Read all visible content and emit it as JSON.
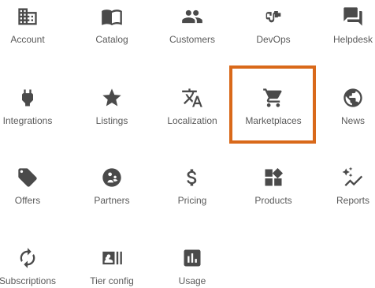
{
  "tiles": [
    {
      "label": "Account",
      "icon": "building-icon"
    },
    {
      "label": "Catalog",
      "icon": "book-icon"
    },
    {
      "label": "Customers",
      "icon": "people-icon"
    },
    {
      "label": "DevOps",
      "icon": "plug-connector-icon"
    },
    {
      "label": "Helpdesk",
      "icon": "chat-icon"
    },
    {
      "label": "Integrations",
      "icon": "plug-icon"
    },
    {
      "label": "Listings",
      "icon": "star-icon"
    },
    {
      "label": "Localization",
      "icon": "translate-icon"
    },
    {
      "label": "Marketplaces",
      "icon": "cart-icon",
      "selected": true
    },
    {
      "label": "News",
      "icon": "globe-icon"
    },
    {
      "label": "Offers",
      "icon": "tag-icon"
    },
    {
      "label": "Partners",
      "icon": "partners-icon"
    },
    {
      "label": "Pricing",
      "icon": "dollar-icon"
    },
    {
      "label": "Products",
      "icon": "products-icon"
    },
    {
      "label": "Reports",
      "icon": "sparkline-icon"
    },
    {
      "label": "Subscriptions",
      "icon": "refresh-icon"
    },
    {
      "label": "Tier config",
      "icon": "tier-config-icon"
    },
    {
      "label": "Usage",
      "icon": "bar-chart-icon"
    }
  ],
  "colors": {
    "icon": "#4a4a4a",
    "label": "#5a5a5a",
    "selection_border": "#d9691a"
  }
}
